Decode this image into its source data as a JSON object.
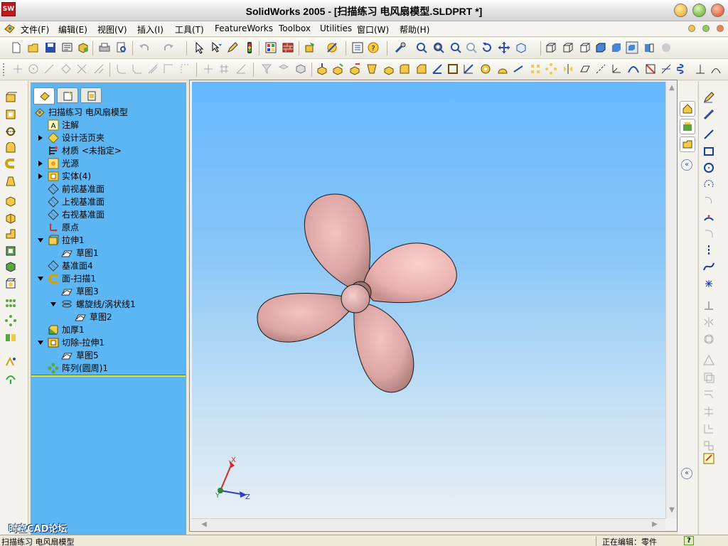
{
  "window": {
    "title": "SolidWorks 2005 - [扫描练习 电风扇模型.SLDPRT *]",
    "app_icon": "SW"
  },
  "menubar": {
    "items": [
      "文件(F)",
      "编辑(E)",
      "视图(V)",
      "插入(I)",
      "工具(T)",
      "FeatureWorks",
      "Toolbox",
      "Utilities",
      "窗口(W)",
      "帮助(H)"
    ]
  },
  "feature_tree": {
    "root": "扫描练习 电风扇模型",
    "items": [
      {
        "label": "注解",
        "icon": "annotation-icon"
      },
      {
        "label": "设计活页夹",
        "icon": "design-binder-icon"
      },
      {
        "label": "材质 <未指定>",
        "icon": "material-icon"
      },
      {
        "label": "光源",
        "icon": "lights-icon"
      },
      {
        "label": "实体(4)",
        "icon": "solid-bodies-icon"
      },
      {
        "label": "前视基准面",
        "icon": "plane-icon"
      },
      {
        "label": "上视基准面",
        "icon": "plane-icon"
      },
      {
        "label": "右视基准面",
        "icon": "plane-icon"
      },
      {
        "label": "原点",
        "icon": "origin-icon"
      },
      {
        "label": "拉伸1",
        "icon": "extrude-icon"
      },
      {
        "label": "草图1",
        "icon": "sketch-icon"
      },
      {
        "label": "基准面4",
        "icon": "plane-icon"
      },
      {
        "label": "面-扫描1",
        "icon": "sweep-icon"
      },
      {
        "label": "草图3",
        "icon": "sketch-icon"
      },
      {
        "label": "螺旋线/涡状线1",
        "icon": "helix-icon"
      },
      {
        "label": "草图2",
        "icon": "sketch-icon"
      },
      {
        "label": "加厚1",
        "icon": "thicken-icon"
      },
      {
        "label": "切除-拉伸1",
        "icon": "cut-extrude-icon"
      },
      {
        "label": "草图5",
        "icon": "sketch-icon"
      },
      {
        "label": "阵列(圆周)1",
        "icon": "circular-pattern-icon"
      }
    ]
  },
  "viewport": {
    "axis_labels": {
      "x": "X",
      "y": "Y",
      "z": "Z"
    },
    "blade_color": "#e8b0ae",
    "hub_color": "#e8b6b4"
  },
  "statusbar": {
    "message": "扫描练习 电风扇模型",
    "editing": "正在编辑：零件",
    "help": "?"
  },
  "watermark": "时空CAD论坛"
}
